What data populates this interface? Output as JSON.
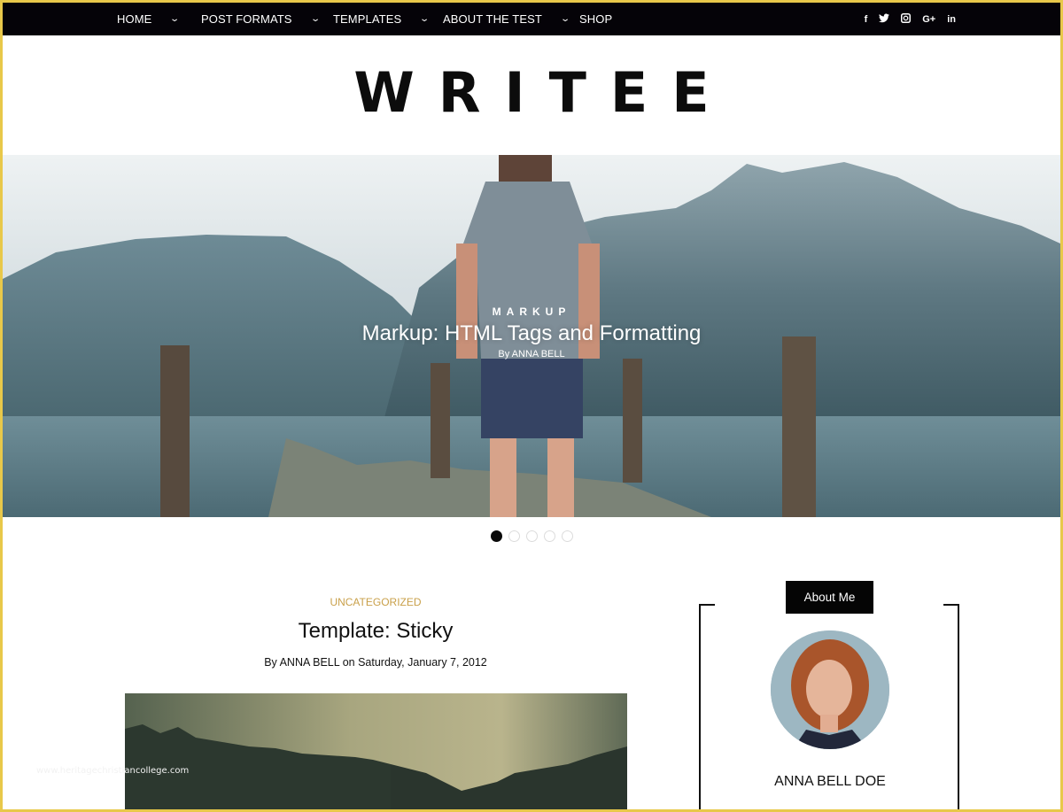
{
  "nav": {
    "items": [
      {
        "label": "HOME",
        "has_dropdown": true
      },
      {
        "label": "POST FORMATS",
        "has_dropdown": true
      },
      {
        "label": "TEMPLATES",
        "has_dropdown": true
      },
      {
        "label": "ABOUT THE TEST",
        "has_dropdown": true
      },
      {
        "label": "SHOP",
        "has_dropdown": false
      }
    ],
    "dropdown_glyph": "⌄",
    "social": [
      {
        "icon": "facebook-icon",
        "glyph": "f"
      },
      {
        "icon": "twitter-icon",
        "glyph": "🐦"
      },
      {
        "icon": "instagram-icon",
        "glyph": "◙"
      },
      {
        "icon": "google-plus-icon",
        "glyph": "G+"
      },
      {
        "icon": "linkedin-icon",
        "glyph": "in"
      }
    ]
  },
  "site": {
    "logo": "WRITEE"
  },
  "hero": {
    "category": "MARKUP",
    "title": "Markup: HTML Tags and Formatting",
    "byline": "By ANNA BELL",
    "slides_total": 5,
    "active_slide": 1
  },
  "post": {
    "category": "UNCATEGORIZED",
    "title": "Template: Sticky",
    "meta": "By ANNA BELL on Saturday, January 7, 2012"
  },
  "sidebar": {
    "widget_title": "About Me",
    "author_name": "ANNA BELL DOE"
  },
  "watermark": "www.heritagechristiancollege.com",
  "colors": {
    "accent_frame": "#e8c84a",
    "nav_bg": "#050308",
    "category_color": "#c9a04a"
  }
}
